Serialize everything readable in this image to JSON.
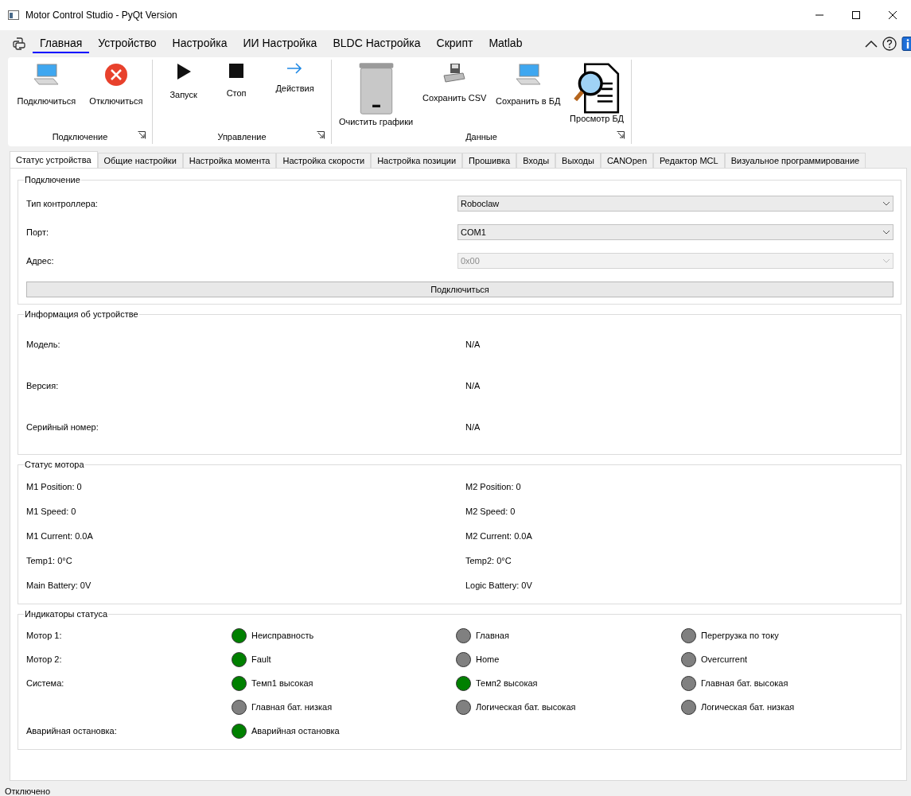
{
  "window": {
    "title": "Motor Control Studio - PyQt Version"
  },
  "menu": [
    {
      "label": "Главная",
      "selected": true
    },
    {
      "label": "Устройство",
      "selected": false
    },
    {
      "label": "Настройка",
      "selected": false
    },
    {
      "label": "ИИ Настройка",
      "selected": false
    },
    {
      "label": "BLDC Настройка",
      "selected": false
    },
    {
      "label": "Скрипт",
      "selected": false
    },
    {
      "label": "Matlab",
      "selected": false
    }
  ],
  "ribbon": [
    {
      "title": "Подключение",
      "buttons": [
        {
          "label": "Подключиться",
          "kind": "monitor"
        },
        {
          "label": "Отключиться",
          "kind": "error"
        }
      ]
    },
    {
      "title": "Управление",
      "buttons": [
        {
          "label": "Запуск",
          "kind": "play"
        },
        {
          "label": "Стоп",
          "kind": "stop"
        },
        {
          "label": "Действия",
          "kind": "arrow"
        }
      ]
    },
    {
      "title": "Данные",
      "buttons": [
        {
          "label": "Очистить графики",
          "kind": "trash"
        },
        {
          "label": "Сохранить CSV",
          "kind": "drive"
        },
        {
          "label": "Сохранить в БД",
          "kind": "monitor"
        },
        {
          "label": "Просмотр БД",
          "kind": "search-doc"
        }
      ]
    }
  ],
  "tabs": [
    {
      "label": "Статус устройства",
      "selected": true
    },
    {
      "label": "Общие настройки",
      "selected": false
    },
    {
      "label": "Настройка момента",
      "selected": false
    },
    {
      "label": "Настройка скорости",
      "selected": false
    },
    {
      "label": "Настройка позиции",
      "selected": false
    },
    {
      "label": "Прошивка",
      "selected": false
    },
    {
      "label": "Входы",
      "selected": false
    },
    {
      "label": "Выходы",
      "selected": false
    },
    {
      "label": "CANOpen",
      "selected": false
    },
    {
      "label": "Редактор MCL",
      "selected": false
    },
    {
      "label": "Визуальное программирование",
      "selected": false
    }
  ],
  "connection": {
    "title": "Подключение",
    "fields": [
      {
        "label": "Тип контроллера:",
        "value": "Roboclaw",
        "disabled": false
      },
      {
        "label": "Порт:",
        "value": "COM1",
        "disabled": false
      },
      {
        "label": "Адрес:",
        "value": "0x00",
        "disabled": true
      }
    ],
    "button": "Подключиться"
  },
  "device_info": {
    "title": "Информация об устройстве",
    "rows": [
      {
        "label": "Модель:",
        "value": "N/A"
      },
      {
        "label": "Версия:",
        "value": "N/A"
      },
      {
        "label": "Серийный номер:",
        "value": "N/A"
      }
    ]
  },
  "motor_status": {
    "title": "Статус мотора",
    "rows": [
      {
        "left": "M1 Position: 0",
        "right": "M2 Position: 0"
      },
      {
        "left": "M1 Speed: 0",
        "right": "M2 Speed: 0"
      },
      {
        "left": "M1 Current: 0.0A",
        "right": "M2 Current: 0.0A"
      },
      {
        "left": "Temp1: 0°C",
        "right": "Temp2: 0°C"
      },
      {
        "left": "Main Battery: 0V",
        "right": "Logic Battery: 0V"
      }
    ]
  },
  "indicators": {
    "title": "Индикаторы статуса",
    "rows": [
      {
        "label": "Мотор 1:",
        "items": [
          {
            "label": "Неисправность",
            "on": true
          },
          {
            "label": "Главная",
            "on": false
          },
          {
            "label": "Перегрузка по току",
            "on": false
          }
        ]
      },
      {
        "label": "Мотор 2:",
        "items": [
          {
            "label": "Fault",
            "on": true
          },
          {
            "label": "Home",
            "on": false
          },
          {
            "label": "Overcurrent",
            "on": false
          }
        ]
      },
      {
        "label": "Система:",
        "items": [
          {
            "label": "Темп1 высокая",
            "on": true
          },
          {
            "label": "Темп2 высокая",
            "on": true
          },
          {
            "label": "Главная бат. высокая",
            "on": false
          }
        ]
      },
      {
        "items": [
          {
            "label": "Главная бат. низкая",
            "on": false
          },
          {
            "label": "Логическая бат. высокая",
            "on": false
          },
          {
            "label": "Логическая бат. низкая",
            "on": false
          }
        ]
      },
      {
        "label": "Аварийная остановка:",
        "items": [
          {
            "label": "Аварийная остановка",
            "on": true
          }
        ]
      }
    ]
  },
  "status_bar": {
    "text": "Отключено"
  }
}
